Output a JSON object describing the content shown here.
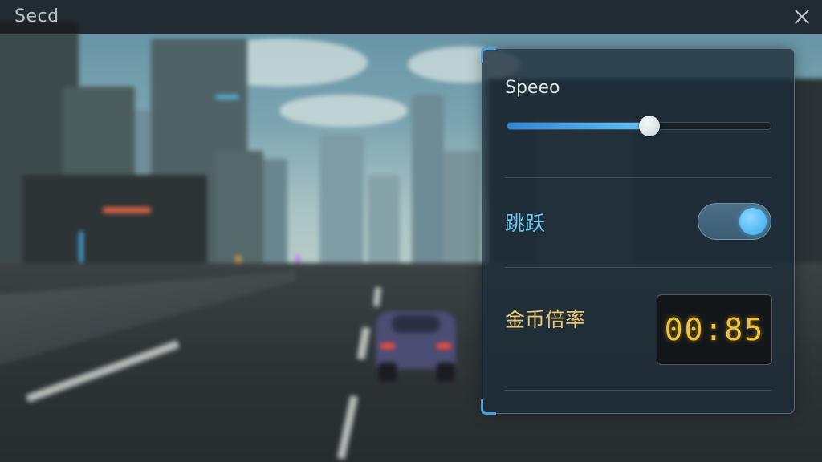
{
  "window": {
    "title": "Secd"
  },
  "settings": {
    "speed": {
      "label": "Speeo",
      "value": 0.54
    },
    "jump": {
      "label": "跳跃",
      "on": true
    },
    "coin_multiplier": {
      "label": "金币倍率",
      "display": "00:85"
    }
  },
  "colors": {
    "accent": "#3ea3e6",
    "jump_label": "#6cc6f0",
    "coin_label": "#e7c66d",
    "coin_digits": "#f2c23a"
  },
  "icons": {
    "close": "close-icon"
  }
}
